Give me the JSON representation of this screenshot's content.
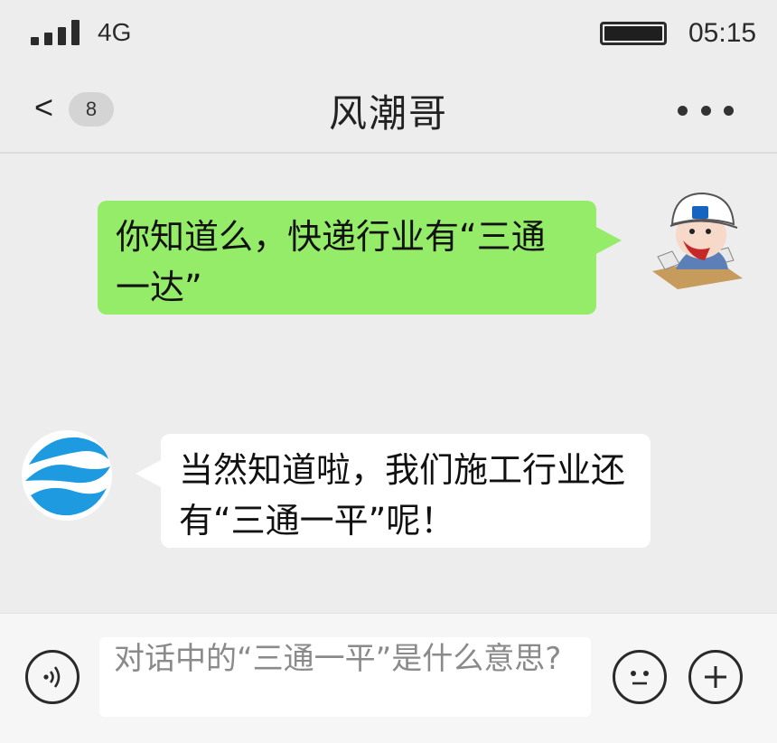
{
  "status_bar": {
    "network": "4G",
    "time": "05:15",
    "battery_level": 1.0,
    "signal_bars": 4
  },
  "nav": {
    "back_glyph": "<",
    "unread_count": "8",
    "title": "风潮哥",
    "more_icon": "ellipsis-icon"
  },
  "messages": [
    {
      "direction": "outgoing",
      "text": "你知道么，快递行业有“三通一达”",
      "avatar": "construction-worker-cartoon-avatar"
    },
    {
      "direction": "incoming",
      "text": "当然知道啦，我们施工行业还有“三通一平”呢！",
      "avatar": "blue-wave-logo-avatar"
    }
  ],
  "input_bar": {
    "voice_icon": "voice-icon",
    "text": "对话中的“三通一平”是什么意思?",
    "emoji_icon": "emoji-icon",
    "plus_icon": "plus-icon"
  },
  "colors": {
    "background": "#ededed",
    "outgoing_bubble": "#95ec69",
    "incoming_bubble": "#ffffff",
    "logo_blue": "#1e9be0"
  }
}
